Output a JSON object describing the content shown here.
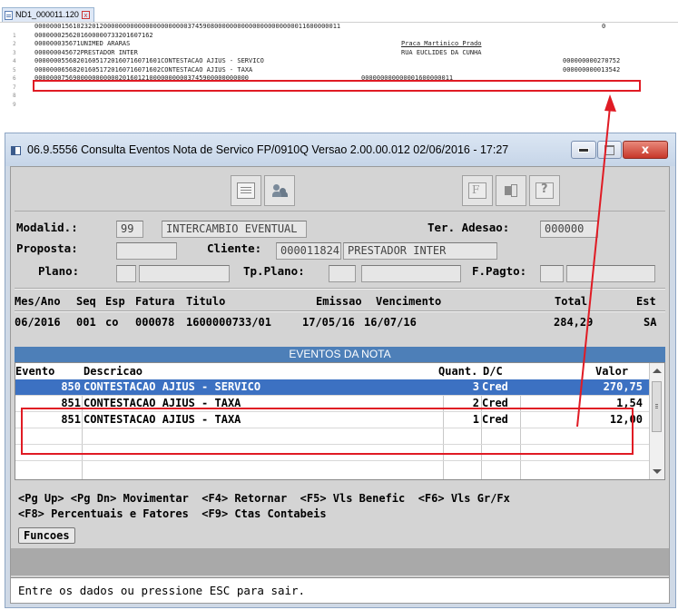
{
  "editor": {
    "tab_label": "ND1_000011.120",
    "lines": [
      {
        "num": "1",
        "text": "00000001561023201200000000000000000000003745908000000000000000000000011600000011",
        "right": "0"
      },
      {
        "num": "2",
        "text": "0000000256201600000733201607162"
      },
      {
        "num": "3",
        "text": "000000035671UNIMED ARARAS",
        "col2": "Praca Martinico Prado"
      },
      {
        "num": "4",
        "text": "000000045672PRESTADOR INTER",
        "col2": "RUA EUCLIDES DA CUNHA"
      },
      {
        "num": "5",
        "text": "000000055682016051720160716071601CONTESTACAO AJIUS - SERVICO",
        "right": "000000000270752"
      },
      {
        "num": "6",
        "text": "000000065682016051720160716071602CONTESTACAO AJIUS - TAXA",
        "right": "000000000013542"
      },
      {
        "num": "7",
        "text": "00000007569000000000002016012100000000003745900000000000",
        "col2": "000000000000001600000011"
      },
      {
        "num": "8",
        "text": ""
      },
      {
        "num": "9",
        "text": ""
      }
    ]
  },
  "window": {
    "title": "06.9.5556  Consulta  Eventos Nota de Servico FP/0910Q Versao 2.00.00.012 02/06/2016 - 17:27",
    "close_glyph": "x"
  },
  "form": {
    "modalid_label": "Modalid.:",
    "modalid_code": "99",
    "modalid_desc": "INTERCAMBIO EVENTUAL",
    "ter_adesao_label": "Ter. Adesao:",
    "ter_adesao_value": "000000",
    "proposta_label": "Proposta:",
    "cliente_label": "Cliente:",
    "cliente_code": "000011824",
    "cliente_name": "PRESTADOR INTER",
    "plano_label": "Plano:",
    "tp_plano_label": "Tp.Plano:",
    "f_pagto_label": "F.Pagto:"
  },
  "invoice": {
    "headers": [
      "Mes/Ano",
      "Seq",
      "Esp",
      "Fatura",
      "Titulo",
      "Emissao",
      "Vencimento",
      "Total",
      "Est"
    ],
    "row": [
      "06/2016",
      "001",
      "co",
      "000078",
      "1600000733/01",
      "17/05/16",
      "16/07/16",
      "284,29",
      "SA"
    ]
  },
  "events": {
    "banner": "EVENTOS DA NOTA",
    "columns": {
      "evento": "Evento",
      "descricao": "Descricao",
      "quant": "Quant.",
      "dc": "D/C",
      "valor": "Valor"
    },
    "rows": [
      {
        "evento": "850",
        "descricao": "CONTESTACAO AJIUS - SERVICO",
        "quant": "3",
        "dc": "Cred",
        "valor": "270,75",
        "selected": true
      },
      {
        "evento": "851",
        "descricao": "CONTESTACAO AJIUS - TAXA",
        "quant": "2",
        "dc": "Cred",
        "valor": "1,54",
        "selected": false
      },
      {
        "evento": "851",
        "descricao": "CONTESTACAO AJIUS - TAXA",
        "quant": "1",
        "dc": "Cred",
        "valor": "12,00",
        "selected": false
      }
    ]
  },
  "keys": {
    "line1": "<Pg Up> <Pg Dn> Movimentar  <F4> Retornar  <F5> Vls Benefic  <F6> Vls Gr/Fx",
    "line2": "<F8> Percentuais e Fatores  <F9> Ctas Contabeis"
  },
  "funcoes_label": "Funcoes",
  "status_text": "Entre os dados ou pressione ESC para sair.",
  "colors": {
    "highlight": "#e01b24",
    "selection": "#3c71c2",
    "banner": "#4d7fb8"
  }
}
